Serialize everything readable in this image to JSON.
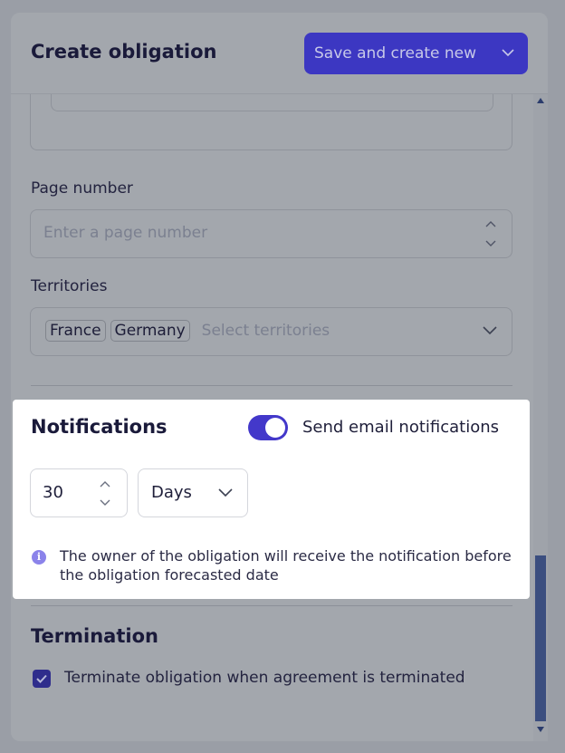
{
  "header": {
    "title": "Create obligation",
    "save_button_label": "Save and create new"
  },
  "form": {
    "page_number": {
      "label": "Page number",
      "placeholder": "Enter a page number"
    },
    "territories": {
      "label": "Territories",
      "selected": [
        "France",
        "Germany"
      ],
      "placeholder": "Select territories"
    }
  },
  "notifications": {
    "title": "Notifications",
    "toggle_label": "Send email notifications",
    "toggle_on": true,
    "amount": "30",
    "unit": "Days",
    "info": "The owner of the obligation will receive the notification before the obligation forecasted date"
  },
  "termination": {
    "title": "Termination",
    "checkbox_label": "Terminate obligation when agreement is terminated",
    "checked": true
  },
  "colors": {
    "accent": "#4338ca",
    "overlay": "#a3a7ad"
  }
}
